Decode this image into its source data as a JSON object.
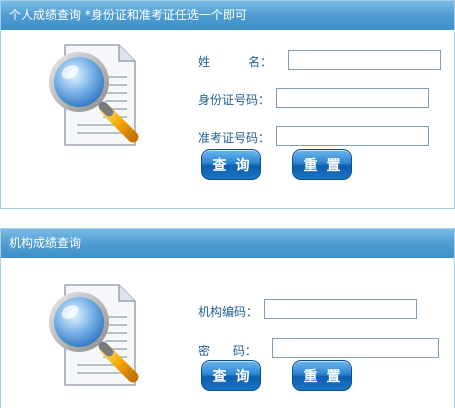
{
  "personal": {
    "title": "个人成绩查询 *身份证和准考证任选一个即可",
    "name_label": "姓          名：",
    "name_value": "",
    "id_label": "身份证号码：",
    "id_value": "",
    "exam_label": "准考证号码：",
    "exam_value": "",
    "query_label": "查询",
    "reset_label": "重置"
  },
  "institution": {
    "title": "机构成绩查询",
    "code_label": "机构编码：",
    "code_value": "",
    "password_label": "密      码：",
    "password_value": "",
    "query_label": "查询",
    "reset_label": "重置"
  }
}
